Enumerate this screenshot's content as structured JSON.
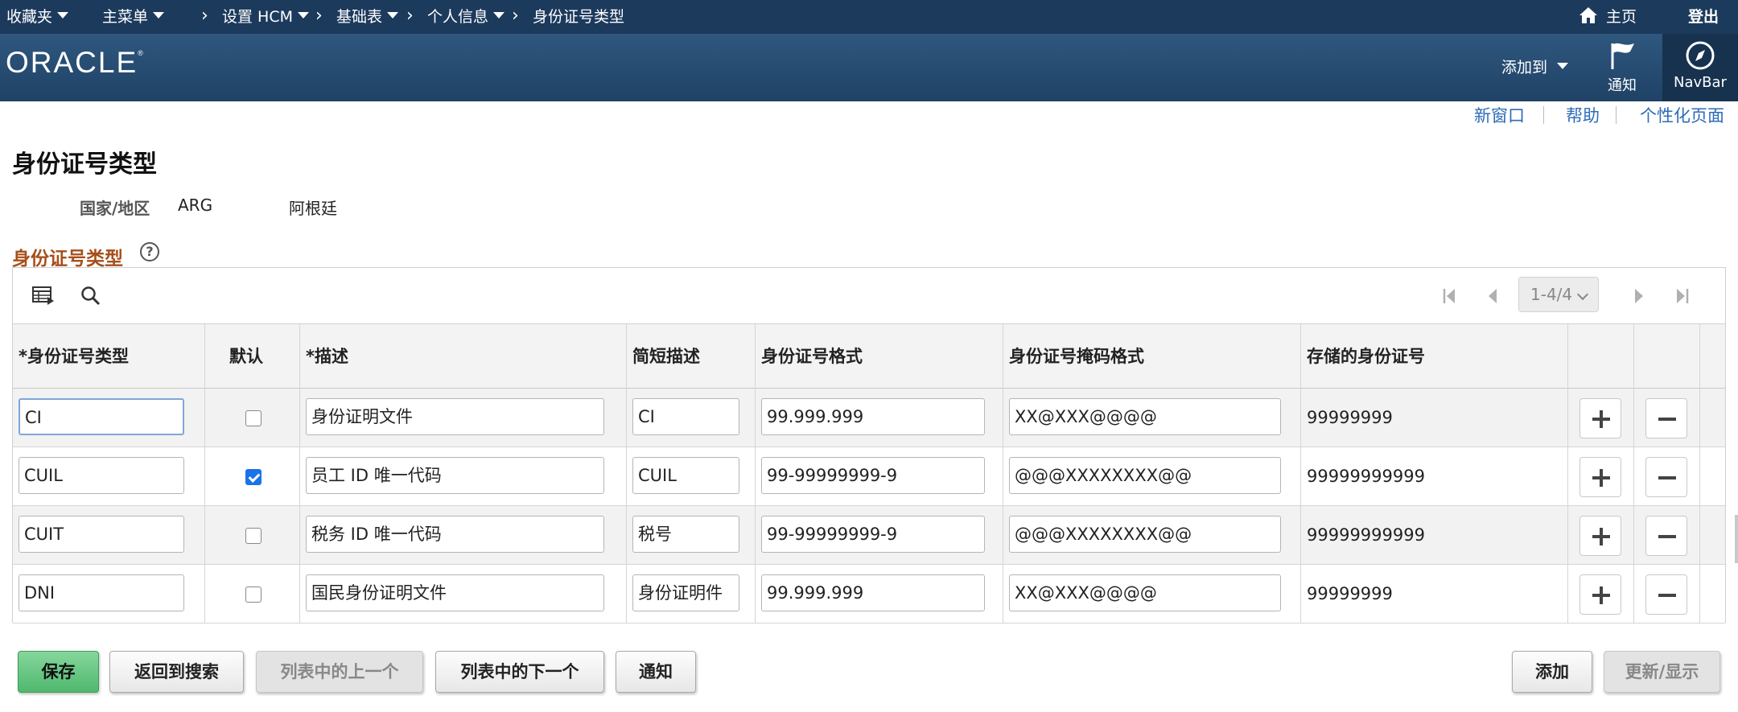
{
  "topbar": {
    "favorites": "收藏夹",
    "main_menu": "主菜单",
    "crumbs": [
      "设置 HCM",
      "基础表",
      "个人信息",
      "身份证号类型"
    ],
    "home": "主页",
    "logout": "登出"
  },
  "header": {
    "logo": "ORACLE",
    "add_to": "添加到",
    "notify": "通知",
    "navbar": "NavBar"
  },
  "page_links": {
    "new_window": "新窗口",
    "help": "帮助",
    "personalize": "个性化页面"
  },
  "page": {
    "title": "身份证号类型",
    "country_label": "国家/地区",
    "country_code": "ARG",
    "country_name": "阿根廷",
    "section_title": "身份证号类型",
    "help_icon": "?"
  },
  "grid": {
    "pager": "1-4/4",
    "columns": [
      "*身份证号类型",
      "默认",
      "*描述",
      "简短描述",
      "身份证号格式",
      "身份证号掩码格式",
      "存储的身份证号"
    ],
    "rows": [
      {
        "type": "CI",
        "default": false,
        "desc": "身份证明文件",
        "short": "CI",
        "format": "99.999.999",
        "mask": "XX@XXX@@@@",
        "stored": "99999999"
      },
      {
        "type": "CUIL",
        "default": true,
        "desc": "员工 ID 唯一代码",
        "short": "CUIL",
        "format": "99-99999999-9",
        "mask": "@@@XXXXXXXX@@",
        "stored": "99999999999"
      },
      {
        "type": "CUIT",
        "default": false,
        "desc": "税务 ID 唯一代码",
        "short": "税号",
        "format": "99-99999999-9",
        "mask": "@@@XXXXXXXX@@",
        "stored": "99999999999"
      },
      {
        "type": "DNI",
        "default": false,
        "desc": "国民身份证明文件",
        "short": "身份证明件",
        "format": "99.999.999",
        "mask": "XX@XXX@@@@",
        "stored": "99999999"
      }
    ]
  },
  "buttons": {
    "save": "保存",
    "return_search": "返回到搜索",
    "prev_in_list": "列表中的上一个",
    "next_in_list": "列表中的下一个",
    "notify": "通知",
    "add": "添加",
    "update_display": "更新/显示"
  }
}
